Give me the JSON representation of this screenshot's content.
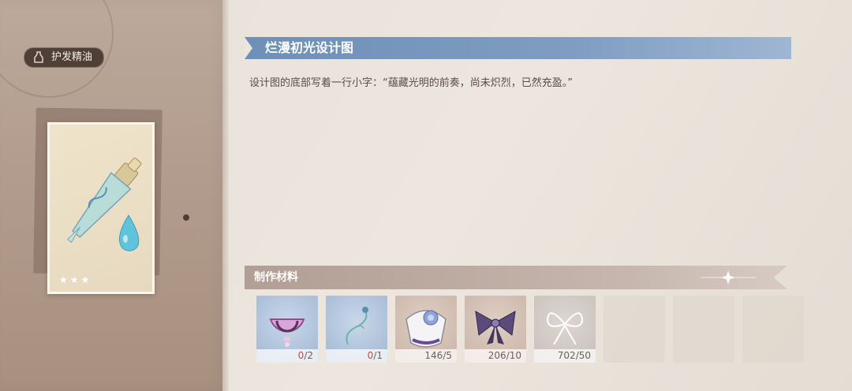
{
  "item": {
    "name": "护发精油",
    "rarity_stars": "★★★"
  },
  "design": {
    "title": "烂漫初光设计图",
    "description": "设计图的底部写着一行小字：“蕴藏光明的前奏，尚未炽烈，已然充盈。”"
  },
  "materials": {
    "header": "制作材料",
    "slots": [
      {
        "icon": "pink-collar-icon",
        "have": "0",
        "need": "/2",
        "short": true
      },
      {
        "icon": "green-vine-icon",
        "have": "0",
        "need": "/1",
        "short": true
      },
      {
        "icon": "silver-cuff-icon",
        "have": "146",
        "need": "/5",
        "short": false
      },
      {
        "icon": "purple-bow-icon",
        "have": "206",
        "need": "/10",
        "short": false
      },
      {
        "icon": "white-ribbon-icon",
        "have": "702",
        "need": "/50",
        "short": false
      }
    ]
  },
  "colors": {
    "title_banner": "#6e8fb7",
    "shortage_red": "#d4403a"
  }
}
